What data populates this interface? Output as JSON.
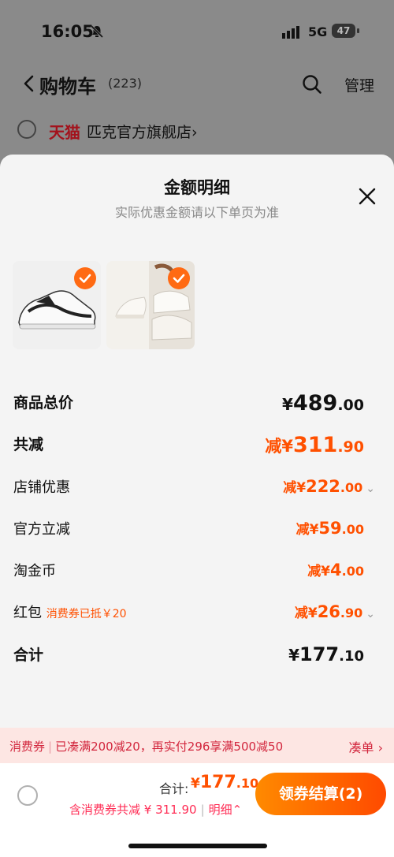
{
  "status_bar": {
    "time": "16:05",
    "network": "5G",
    "battery": "47"
  },
  "nav": {
    "title": "购物车",
    "count": "(223)",
    "manage": "管理"
  },
  "store": {
    "brand": "天猫",
    "name": "匹克官方旗舰店",
    "chevron": "›"
  },
  "sheet": {
    "title": "金额明细",
    "subtitle": "实际优惠金额请以下单页为准",
    "rows": [
      {
        "label": "商品总价",
        "currency": "¥",
        "int": "489",
        "dec": ".00"
      },
      {
        "label": "共减",
        "prefix": "减¥",
        "int": "311",
        "dec": ".90"
      },
      {
        "label": "店铺优惠",
        "prefix": "减¥",
        "int": "222",
        "dec": ".00",
        "chevron": "⌄"
      },
      {
        "label": "官方立减",
        "prefix": "减¥",
        "int": "59",
        "dec": ".00"
      },
      {
        "label": "淘金币",
        "prefix": "减¥",
        "int": "4",
        "dec": ".00"
      },
      {
        "label": "红包",
        "note": "消费券已抵￥20",
        "prefix": "减¥",
        "int": "26",
        "dec": ".90",
        "chevron": "⌄"
      },
      {
        "label": "合计",
        "currency": "¥",
        "int": "177",
        "dec": ".10"
      }
    ]
  },
  "promo": {
    "tag": "消费券",
    "sep": "|",
    "text": "已凑满200减20，再实付296享满500减50",
    "action": "凑单 ›"
  },
  "footer": {
    "total_label": "合计:",
    "total_currency": "¥",
    "total_int": "177",
    "total_dec": ".10",
    "sub": "含消费券共减 ¥ 311.90",
    "sep": "|",
    "detail": "明细⌃",
    "checkout": "领券结算(2)"
  },
  "colors": {
    "accent": "#ff5000",
    "red": "#d2263d",
    "sheet_bg": "#f4f4f4"
  }
}
